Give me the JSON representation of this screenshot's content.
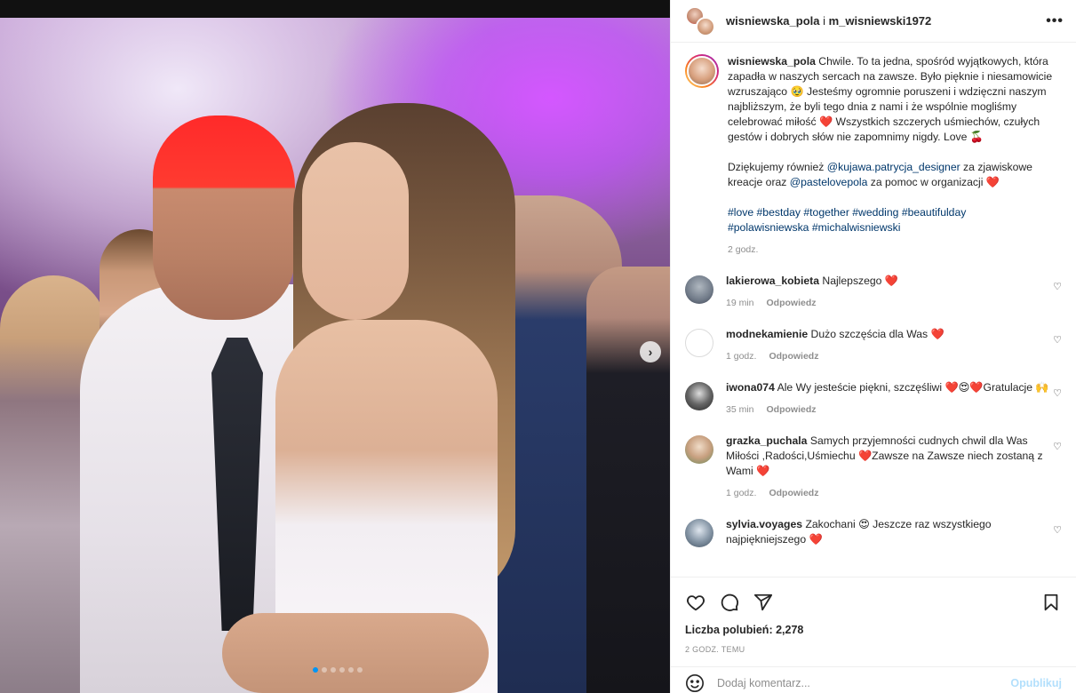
{
  "media": {
    "next_arrow": "›",
    "slide_count": 6,
    "active_slide": 1
  },
  "header": {
    "user1": "wisniewska_pola",
    "separator": " i ",
    "user2": "m_wisniewski1972",
    "more": "•••"
  },
  "caption": {
    "username": "wisniewska_pola",
    "p1": "Chwile. To ta jedna, spośród wyjątkowych, która zapadła w naszych sercach na zawsze. Było pięknie i niesamowicie wzruszająco 🥹 Jesteśmy ogromnie poruszeni i wdzięczni naszym najbliższym, że byli tego dnia z nami i że wspólnie mogliśmy celebrować miłość",
    "p1_emoji": "❤️",
    "p1_tail": "Wszystkich szczerych uśmiechów, czułych gestów i dobrych słów nie zapomnimy nigdy. Love",
    "p1_end_emoji": "🍒",
    "p2_a": "Dziękujemy również ",
    "p2_mention1": "@kujawa.patrycja_designer",
    "p2_b": " za zjawiskowe kreacje oraz ",
    "p2_mention2": "@pastelovepola",
    "p2_c": " za pomoc w organizacji ",
    "p2_emoji": "❤️",
    "hashtags_line1": "#love #bestday #together #wedding #beautifulday",
    "hashtags_line2": "#polawisniewska #michalwisniewski",
    "time": "2 godz."
  },
  "comments": [
    {
      "username": "lakierowa_kobieta",
      "text": "Najlepszego",
      "emoji": "❤️",
      "time": "19 min",
      "reply": "Odpowiedz"
    },
    {
      "username": "modnekamienie",
      "text": "Dużo szczęścia dla Was",
      "emoji": "❤️",
      "time": "1 godz.",
      "reply": "Odpowiedz"
    },
    {
      "username": "iwona074",
      "text": "Ale Wy jesteście piękni, szczęśliwi ❤️😍❤️Gratulacje 🙌",
      "emoji": "",
      "time": "35 min",
      "reply": "Odpowiedz"
    },
    {
      "username": "grazka_puchala",
      "text": "Samych przyjemności cudnych chwil dla Was Miłości ,Radości,Uśmiechu ❤️Zawsze na Zawsze niech zostaną z Wami",
      "emoji": "❤️",
      "time": "1 godz.",
      "reply": "Odpowiedz"
    },
    {
      "username": "sylvia.voyages",
      "text": "Zakochani 😍 Jeszcze raz wszystkiego najpiękniejszego",
      "emoji": "❤️",
      "time": "",
      "reply": ""
    }
  ],
  "comment_heart": "♡",
  "actions": {
    "likes_label": "Liczba polubień: 2,278",
    "time_label": "2 godz. temu"
  },
  "comment_box": {
    "placeholder": "Dodaj komentarz...",
    "publish": "Opublikuj"
  }
}
